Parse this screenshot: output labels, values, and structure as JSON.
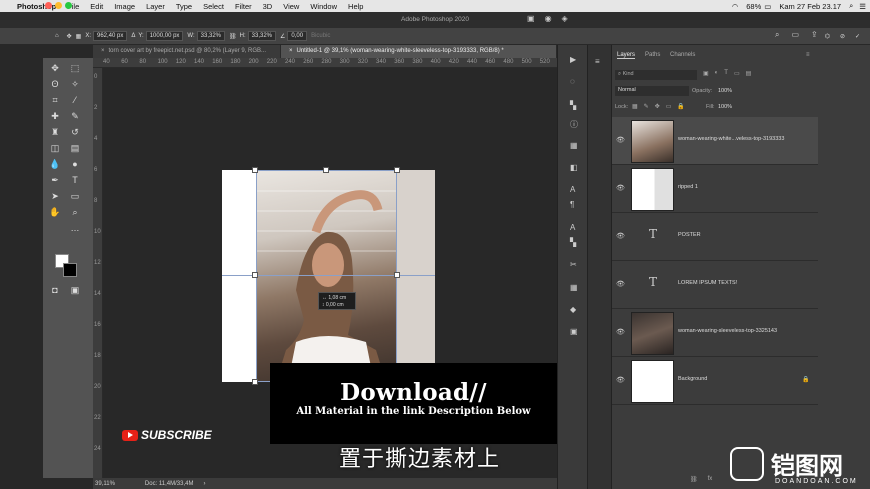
{
  "menubar": {
    "app": "Photoshop",
    "items": [
      "File",
      "Edit",
      "Image",
      "Layer",
      "Type",
      "Select",
      "Filter",
      "3D",
      "View",
      "Window",
      "Help"
    ],
    "window_title": "Adobe Photoshop 2020",
    "battery": "68%",
    "clock": "Kam 27 Feb  23.17"
  },
  "options": {
    "x_label": "X:",
    "x_value": "962,40 px",
    "y_label": "Y:",
    "y_value": "1000,00 px",
    "w_label": "W:",
    "w_value": "33,32%",
    "h_label": "H:",
    "h_value": "33,32%",
    "angle_value": "0,00",
    "interp": "Bicubic"
  },
  "tabs": [
    {
      "label": "torn cover art by freepict.net.psd @ 80,2% (Layer 9, RGB..."
    },
    {
      "label": "Untitled-1 @ 39,1% (woman-wearing-white-sleeveless-top-3193333, RGB/8) *"
    }
  ],
  "ruler": [
    "40",
    "60",
    "80",
    "100",
    "120",
    "140",
    "160",
    "180",
    "200",
    "220",
    "240",
    "260",
    "280",
    "300",
    "320",
    "340",
    "360",
    "380",
    "400",
    "420",
    "440",
    "460",
    "480",
    "500",
    "520"
  ],
  "ruler_v": [
    "0",
    "2",
    "4",
    "6",
    "8",
    "10",
    "12",
    "14",
    "16",
    "18",
    "20",
    "22",
    "24"
  ],
  "transform_readout": {
    "w": "↔ 1,08 cm",
    "h": "↕ 0,00 cm"
  },
  "status": {
    "zoom": "39,11%",
    "doc": "Doc: 11,4M/33,4M"
  },
  "overlay": {
    "title": "Download//",
    "subtitle": "All Material in the link Description Below",
    "subscribe": "SUBSCRIBE",
    "chinese_caption": "置于撕边素材上"
  },
  "layers_panel": {
    "tabs": [
      "Layers",
      "Paths",
      "Channels"
    ],
    "kind": "Kind",
    "blend": "Normal",
    "opacity_label": "Opacity:",
    "opacity": "100%",
    "lock_label": "Lock:",
    "fill_label": "Fill:",
    "fill": "100%",
    "layers": [
      {
        "name": "woman-wearing-white...veless-top-3193333",
        "type": "image"
      },
      {
        "name": "ripped 1",
        "type": "image"
      },
      {
        "name": "POSTER",
        "type": "text"
      },
      {
        "name": "LOREM IPSUM TEXTS!",
        "type": "text"
      },
      {
        "name": "woman-wearing-sleeveless-top-3325143",
        "type": "image"
      },
      {
        "name": "Background",
        "type": "background"
      }
    ]
  },
  "watermark": {
    "brand": "铠图网",
    "url": "DOANDOAN.COM"
  }
}
